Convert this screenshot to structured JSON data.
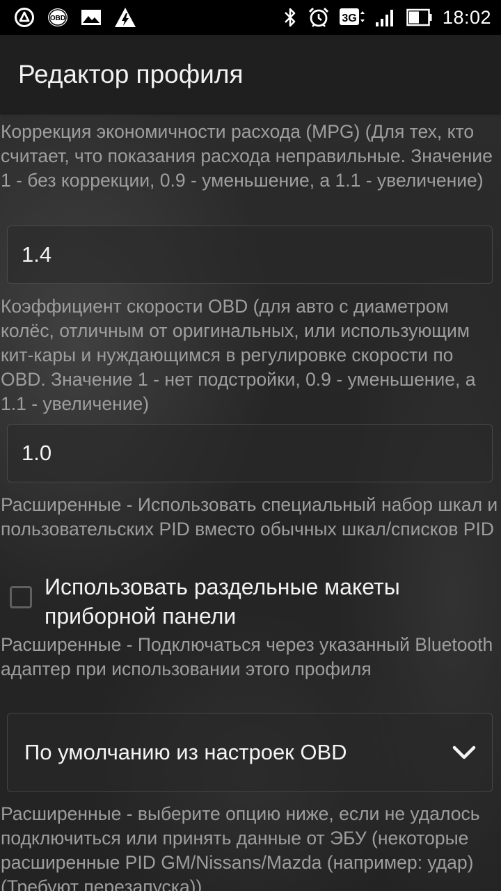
{
  "status_bar": {
    "icons_left": [
      "ring-a-icon",
      "obd-icon",
      "image-icon",
      "warning-icon"
    ],
    "obd_label": "OBD",
    "network_label": "3G",
    "icons_right": [
      "bluetooth-icon",
      "alarm-icon",
      "network-3g-icon",
      "signal-icon",
      "battery-icon"
    ],
    "time": "18:02"
  },
  "action_bar": {
    "title": "Редактор профиля"
  },
  "settings": {
    "mpg_correction": {
      "description": "Коррекция экономичности расхода (MPG) (Для тех, кто считает, что показания расхода неправильные. Значение 1 - без коррекции, 0.9 - уменьшение, а 1.1 - увеличение)",
      "value": "1.4"
    },
    "speed_coefficient": {
      "description": "Коэффициент скорости OBD (для авто с диаметром колёс, отличным от оригинальных, или использующим кит-кары и нуждающимся в регулировке скорости по OBD. Значение 1 - нет подстройки, 0.9 - уменьшение, а 1.1 - увеличение)",
      "value": "1.0"
    },
    "advanced_layouts": {
      "description": "Расширенные - Использовать специальный набор шкал и пользовательских PID вместо обычных шкал/списков PID",
      "checkbox_label": "Использовать раздельные макеты приборной панели",
      "checked": false
    },
    "bluetooth_adapter": {
      "description": "Расширенные - Подключаться через указанный Bluetooth адаптер при использовании этого профиля",
      "selected": "По умолчанию из настроек OBD"
    },
    "advanced_pids": {
      "description": "Расширенные - выберите опцию ниже, если не удалось подключиться или принять данные от ЭБУ (некоторые расширенные PID GM/Nissans/Mazda (например: удар) (Требуют перезапуска))"
    }
  },
  "colors": {
    "background": "#262626",
    "description_text": "#9e9e9e",
    "value_text": "#f4f4f4",
    "status_bar": "#000000"
  }
}
